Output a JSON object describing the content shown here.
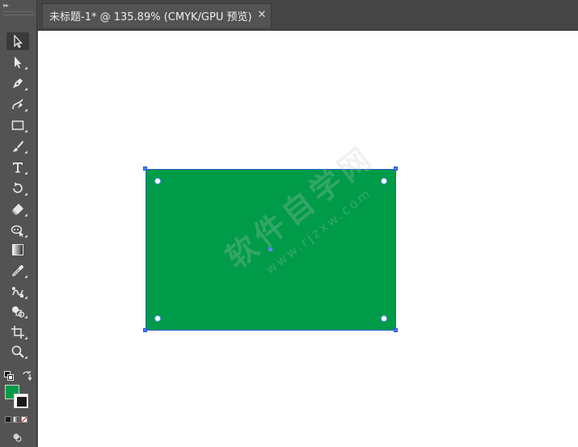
{
  "document": {
    "tab_title": "未标题-1* @ 135.89% (CMYK/GPU 预览)",
    "close_glyph": "✕"
  },
  "toolbar": {
    "collapse_glyph": "▸▸",
    "tools": [
      {
        "name": "selection-tool-icon",
        "active": true
      },
      {
        "name": "direct-selection-tool-icon"
      },
      {
        "name": "pen-tool-icon"
      },
      {
        "name": "curvature-tool-icon"
      },
      {
        "name": "rectangle-tool-icon"
      },
      {
        "name": "paintbrush-tool-icon"
      },
      {
        "name": "type-tool-icon"
      },
      {
        "name": "rotate-tool-icon"
      },
      {
        "name": "eraser-tool-icon"
      },
      {
        "name": "puppet-warp-tool-icon"
      },
      {
        "name": "gradient-tool-icon"
      },
      {
        "name": "eyedropper-tool-icon"
      },
      {
        "name": "blend-tool-icon"
      },
      {
        "name": "shape-builder-tool-icon"
      },
      {
        "name": "artboard-tool-icon"
      },
      {
        "name": "zoom-tool-icon"
      }
    ]
  },
  "colors": {
    "fill": "#009b48",
    "stroke": "#1a1a1a",
    "selection": "#2e5bd3"
  },
  "watermark": {
    "cn": "软件自学网",
    "url": "www.rjzxw.com"
  }
}
